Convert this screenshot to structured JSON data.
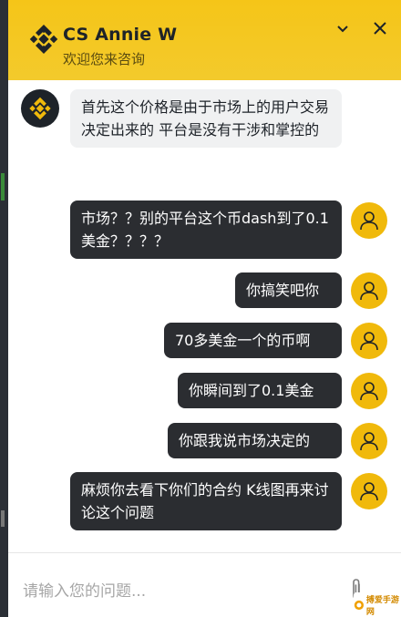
{
  "header": {
    "title": "CS Annie W",
    "subtitle": "欢迎您来咨询",
    "colors": {
      "background": "#f5c518",
      "logo": "#1e2329"
    }
  },
  "messages": [
    {
      "sender": "agent",
      "text": "首先这个价格是由于市场上的用户交易决定出来的 平台是没有干涉和掌控的"
    },
    {
      "sender": "user",
      "text": "市场？？别的平台这个币dash到了0.1美金？？？？"
    },
    {
      "sender": "user",
      "text": "你搞笑吧你"
    },
    {
      "sender": "user",
      "text": "70多美金一个的币啊"
    },
    {
      "sender": "user",
      "text": "你瞬间到了0.1美金"
    },
    {
      "sender": "user",
      "text": "你跟我说市场决定的"
    },
    {
      "sender": "user",
      "text": "麻烦你去看下你们的合约 K线图再来讨论这个问题"
    }
  ],
  "input": {
    "placeholder": "请输入您的问题..."
  },
  "watermark": {
    "text": "搏爱手游网"
  },
  "icons": {
    "logo": "binance-logo-icon",
    "minimize": "chevron-down-icon",
    "close": "close-icon",
    "user_avatar": "user-icon",
    "attach": "paperclip-icon"
  }
}
